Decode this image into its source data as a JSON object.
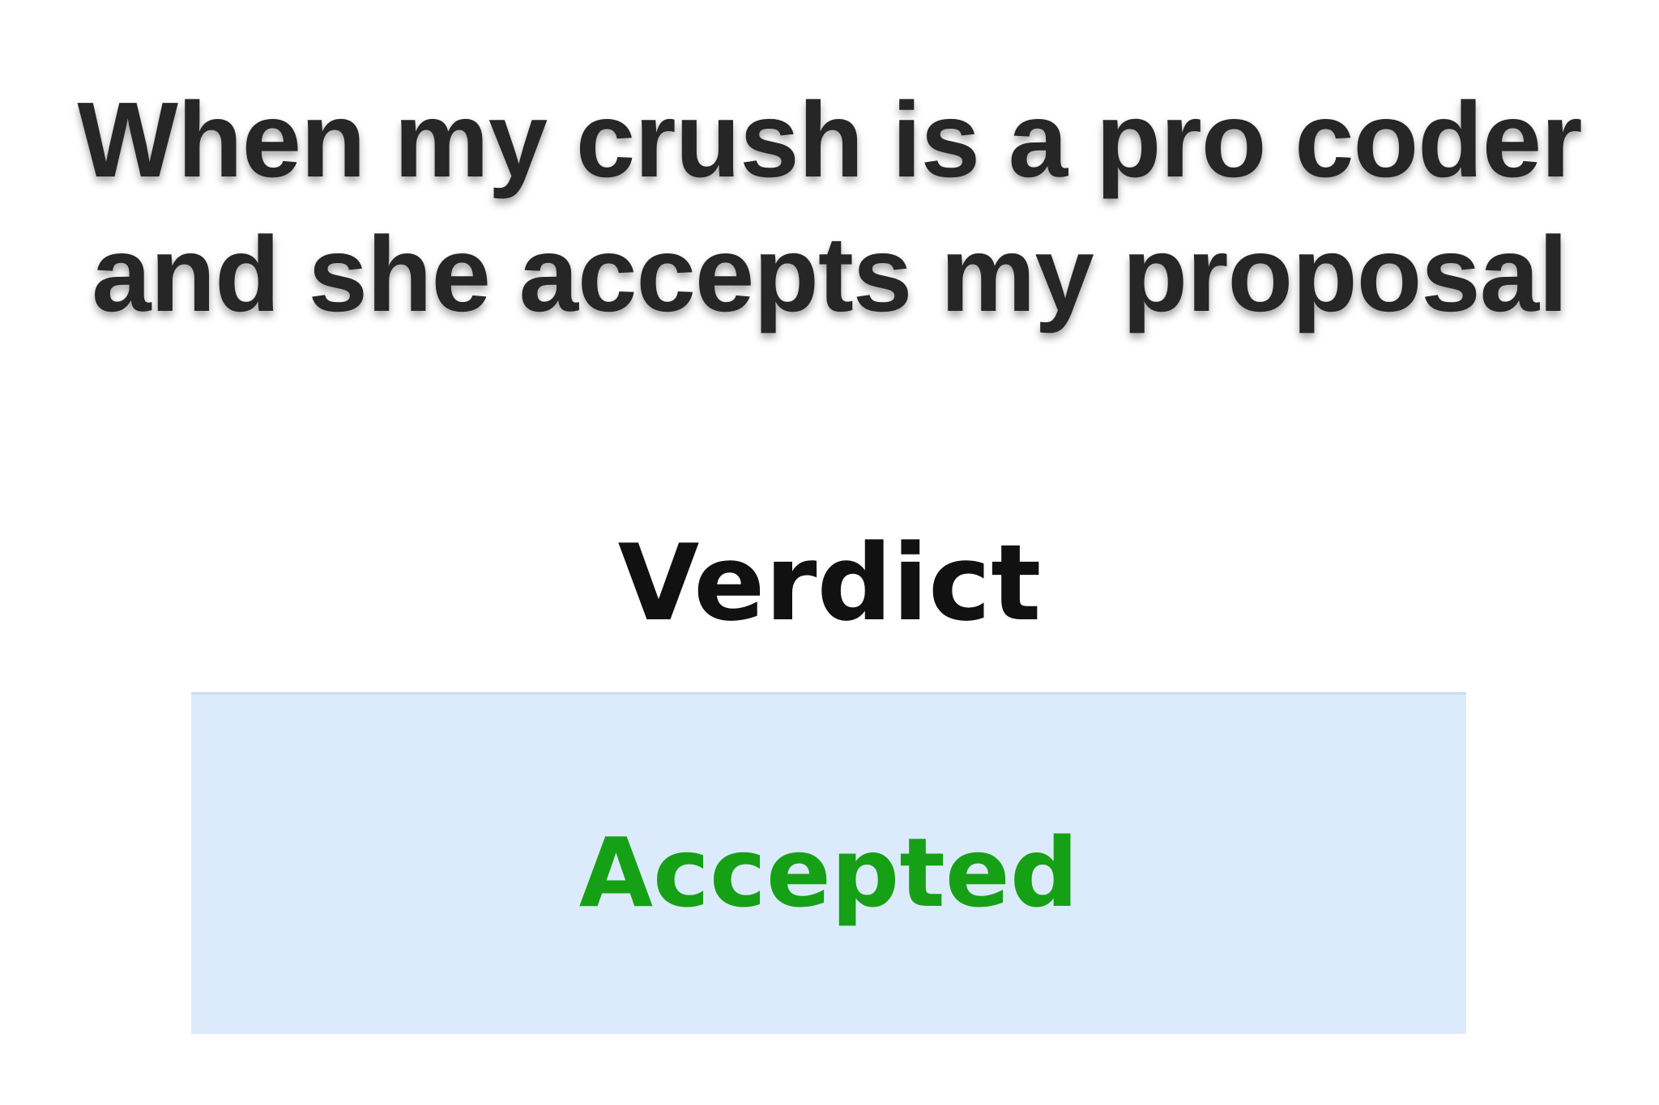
{
  "caption": {
    "line1": "When my crush is a pro coder",
    "line2": "and she accepts my proposal"
  },
  "verdict_table": {
    "header": "Verdict",
    "status": "Accepted",
    "status_color": "#16a016",
    "cell_background": "#dcebfb"
  }
}
